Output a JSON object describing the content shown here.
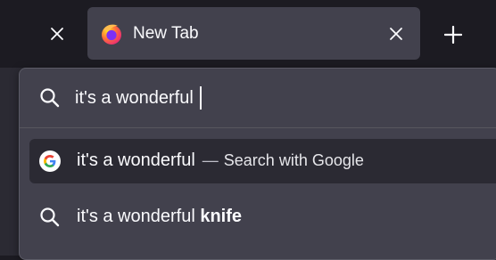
{
  "tabs": {
    "active_tab_title": "New Tab"
  },
  "urlbar": {
    "input_value": "it's a wonderful"
  },
  "suggestions": [
    {
      "text": "it's a wonderful",
      "separator": "—",
      "action": "Search with Google",
      "icon": "google-icon",
      "selected": true
    },
    {
      "text": "it's a wonderful",
      "bold_completion": "knife",
      "icon": "search-icon",
      "selected": false
    }
  ],
  "colors": {
    "tabstrip_bg": "#1c1b22",
    "active_tab_bg": "#42414d",
    "urlbar_bg": "#42414d",
    "selected_row_bg": "#2b2a33",
    "text": "#fbfbfe"
  }
}
